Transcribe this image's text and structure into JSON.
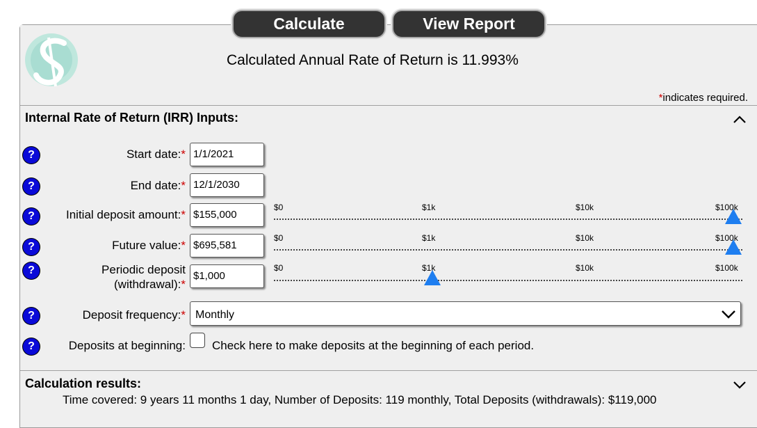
{
  "toolbar": {
    "calculate_label": "Calculate",
    "report_label": "View Report"
  },
  "header": {
    "result_text": "Calculated Annual Rate of Return is 11.993%",
    "required_star": "*",
    "required_text": "indicates required."
  },
  "inputs_section": {
    "title": "Internal Rate of Return (IRR) Inputs:",
    "help_glyph": "?",
    "required_star": "*",
    "fields": {
      "start_date": {
        "label": "Start date:",
        "value": "1/1/2021"
      },
      "end_date": {
        "label": "End date:",
        "value": "12/1/2030"
      },
      "initial_deposit": {
        "label": "Initial deposit amount:",
        "value": "$155,000",
        "slider_position": "$100k"
      },
      "future_value": {
        "label": "Future value:",
        "value": "$695,581",
        "slider_position": "$100k"
      },
      "periodic_deposit": {
        "label_line1": "Periodic deposit",
        "label_line2": "(withdrawal):",
        "value": "$1,000",
        "slider_position": "$1k"
      },
      "deposit_frequency": {
        "label": "Deposit frequency:",
        "value": "Monthly"
      },
      "deposits_beginning": {
        "label": "Deposits at beginning:",
        "checkbox_text": "Check here to make deposits at the beginning of each period.",
        "checked": false
      }
    },
    "slider_ticks": [
      "$0",
      "$1k",
      "$10k",
      "$100k"
    ]
  },
  "results_section": {
    "title": "Calculation results:",
    "summary": "Time covered: 9 years 11 months 1 day, Number of Deposits: 119 monthly, Total Deposits (withdrawals): $119,000"
  },
  "colors": {
    "button_bg": "#333333",
    "panel_bg": "#efefef",
    "help_bg": "#0a0ad8",
    "slider_thumb": "#1e7ef0",
    "required": "#cc0000"
  }
}
